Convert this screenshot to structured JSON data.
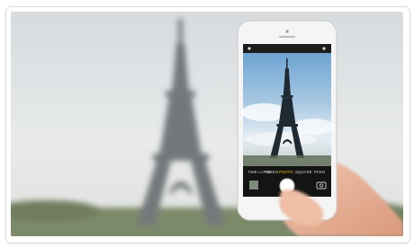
{
  "photo": {
    "subject": "phone-photographing-eiffel-tower"
  },
  "camera_ui": {
    "modes": [
      "TIME-LAPSE",
      "VIDEO",
      "PHOTO",
      "SQUARE",
      "PANO"
    ],
    "selected_mode": "PHOTO",
    "accent_color": "#f5c400"
  },
  "colors": {
    "sky_top": "#d9dde0",
    "sky_bottom": "#eef0f1",
    "tower_blur": "#6f7270",
    "screen_sky": "#7fb0d9",
    "phone_body": "#f4f4f4"
  }
}
